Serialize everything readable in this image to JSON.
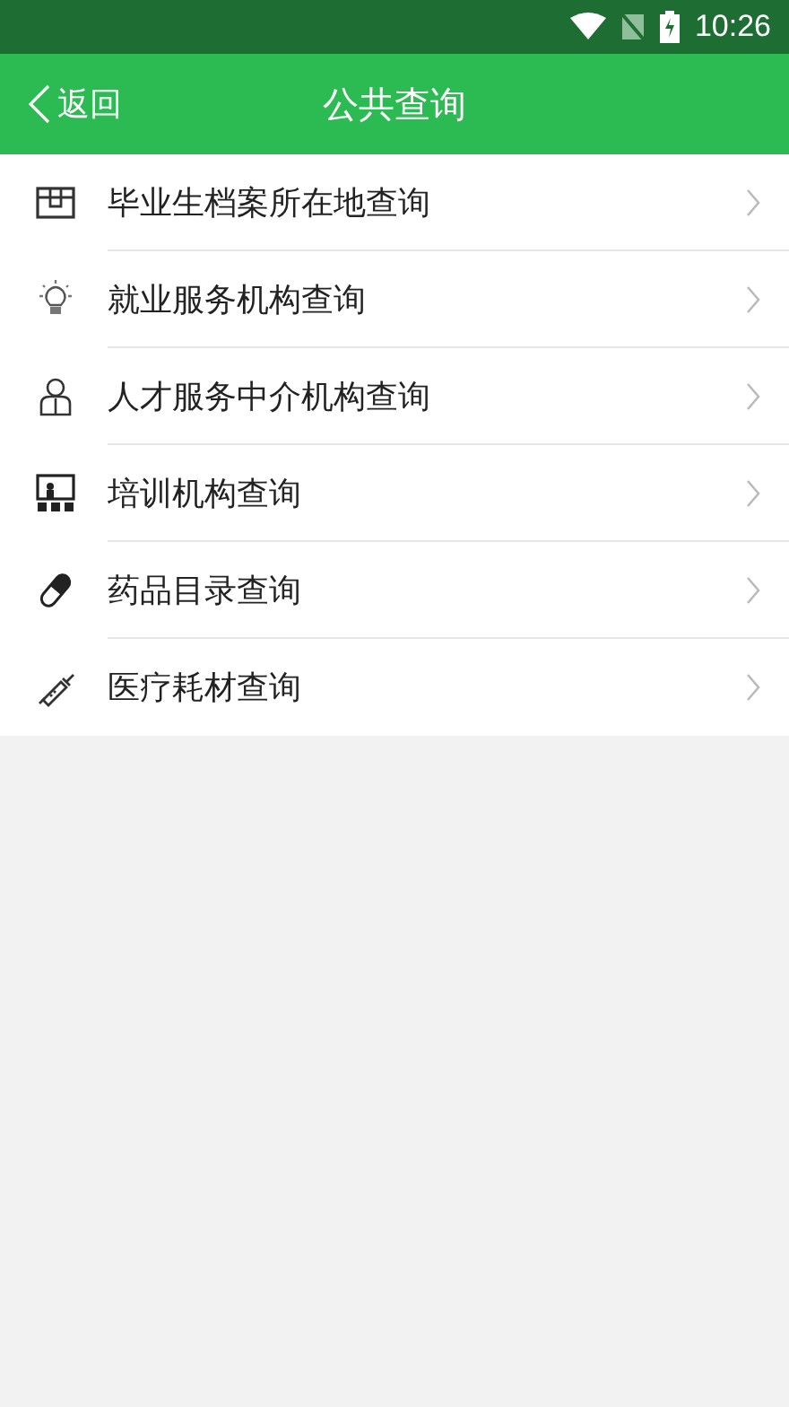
{
  "status_bar": {
    "time": "10:26"
  },
  "header": {
    "back": "返回",
    "title": "公共查询"
  },
  "items": [
    {
      "label": "毕业生档案所在地查询"
    },
    {
      "label": "就业服务机构查询"
    },
    {
      "label": "人才服务中介机构查询"
    },
    {
      "label": "培训机构查询"
    },
    {
      "label": "药品目录查询"
    },
    {
      "label": "医疗耗材查询"
    }
  ]
}
